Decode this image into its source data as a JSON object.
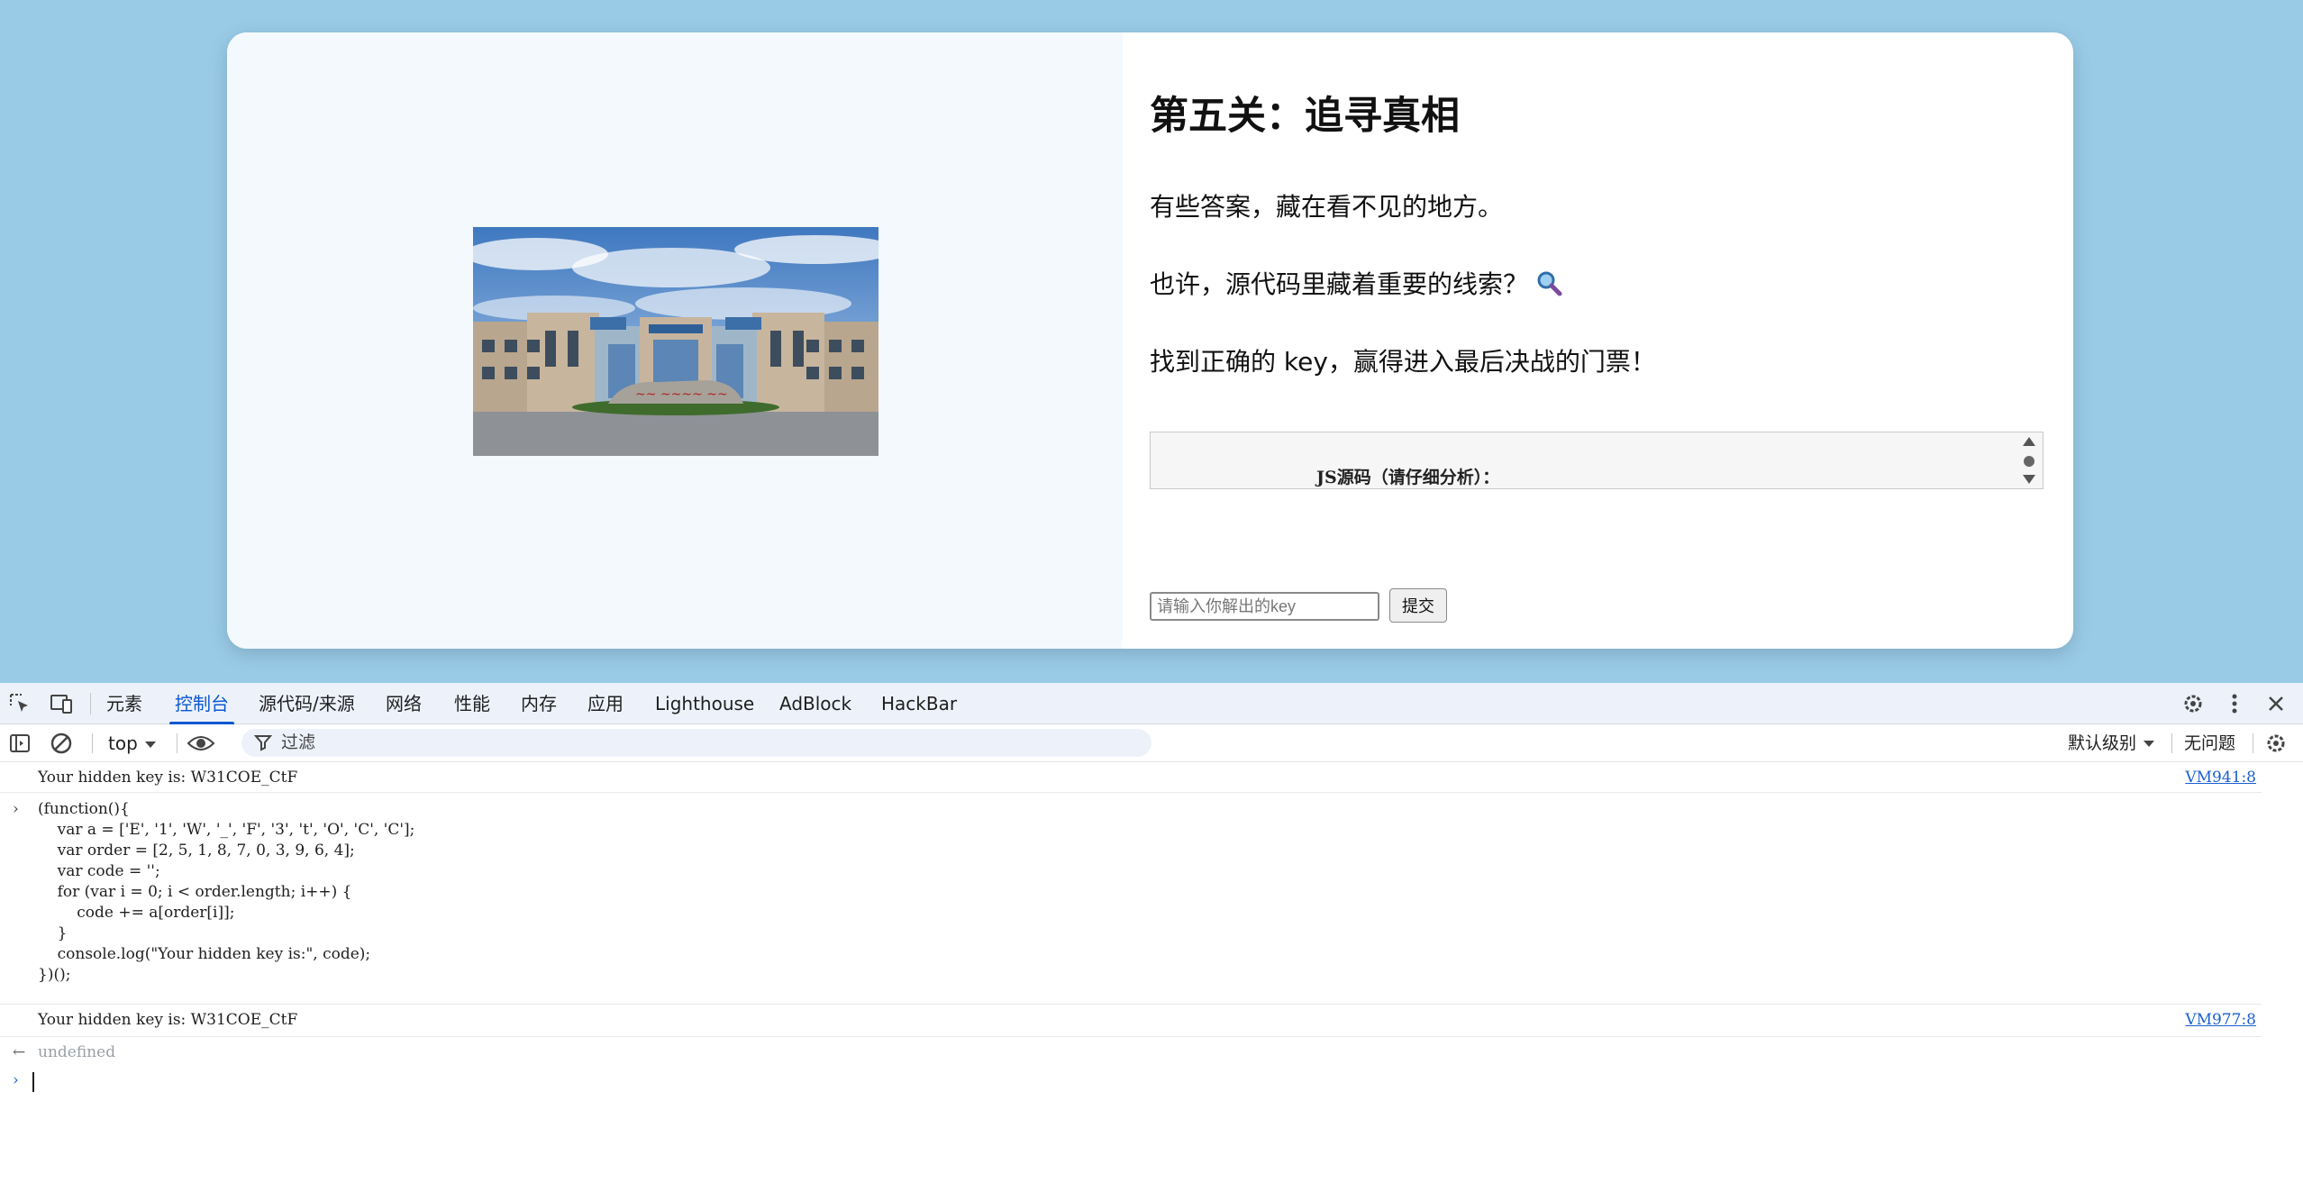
{
  "page": {
    "title": "第五关：追寻真相",
    "paragraphs": [
      "有些答案，藏在看不见的地方。",
      "也许，源代码里藏着重要的线索？",
      "找到正确的 key，赢得进入最后决战的门票！"
    ],
    "hint_icon": "magnifier-icon",
    "source_box_label": "JS源码（请仔细分析）：",
    "key_input_placeholder": "请输入你解出的key",
    "key_input_value": "",
    "submit_label": "提交",
    "colors": {
      "background": "#99cbe7",
      "card": "#ffffff",
      "left_panel": "#f3f9fc"
    }
  },
  "devtools": {
    "tabs": [
      "元素",
      "控制台",
      "源代码/来源",
      "网络",
      "性能",
      "内存",
      "应用",
      "Lighthouse",
      "AdBlock",
      "HackBar"
    ],
    "active_tab": "控制台",
    "context": "top",
    "filter_placeholder": "过滤",
    "levels_label": "默认级别",
    "issues_label": "无问题",
    "accent_color": "#0b57d0"
  },
  "console": {
    "messages": [
      {
        "text": "Your hidden key is: W31COE_CtF",
        "source": "VM941:8"
      },
      {
        "text": "Your hidden key is: W31COE_CtF",
        "source": "VM977:8"
      }
    ],
    "code_lines": [
      "(function(){",
      "    var a = ['E', '1', 'W', '_', 'F', '3', 't', 'O', 'C', 'C'];",
      "    var order = [2, 5, 1, 8, 7, 0, 3, 9, 6, 4];",
      "    var code = '';",
      "    for (var i = 0; i < order.length; i++) {",
      "        code += a[order[i]];",
      "    }",
      "    console.log(\"Your hidden key is:\", code);",
      "})();"
    ],
    "return_value": "undefined"
  }
}
